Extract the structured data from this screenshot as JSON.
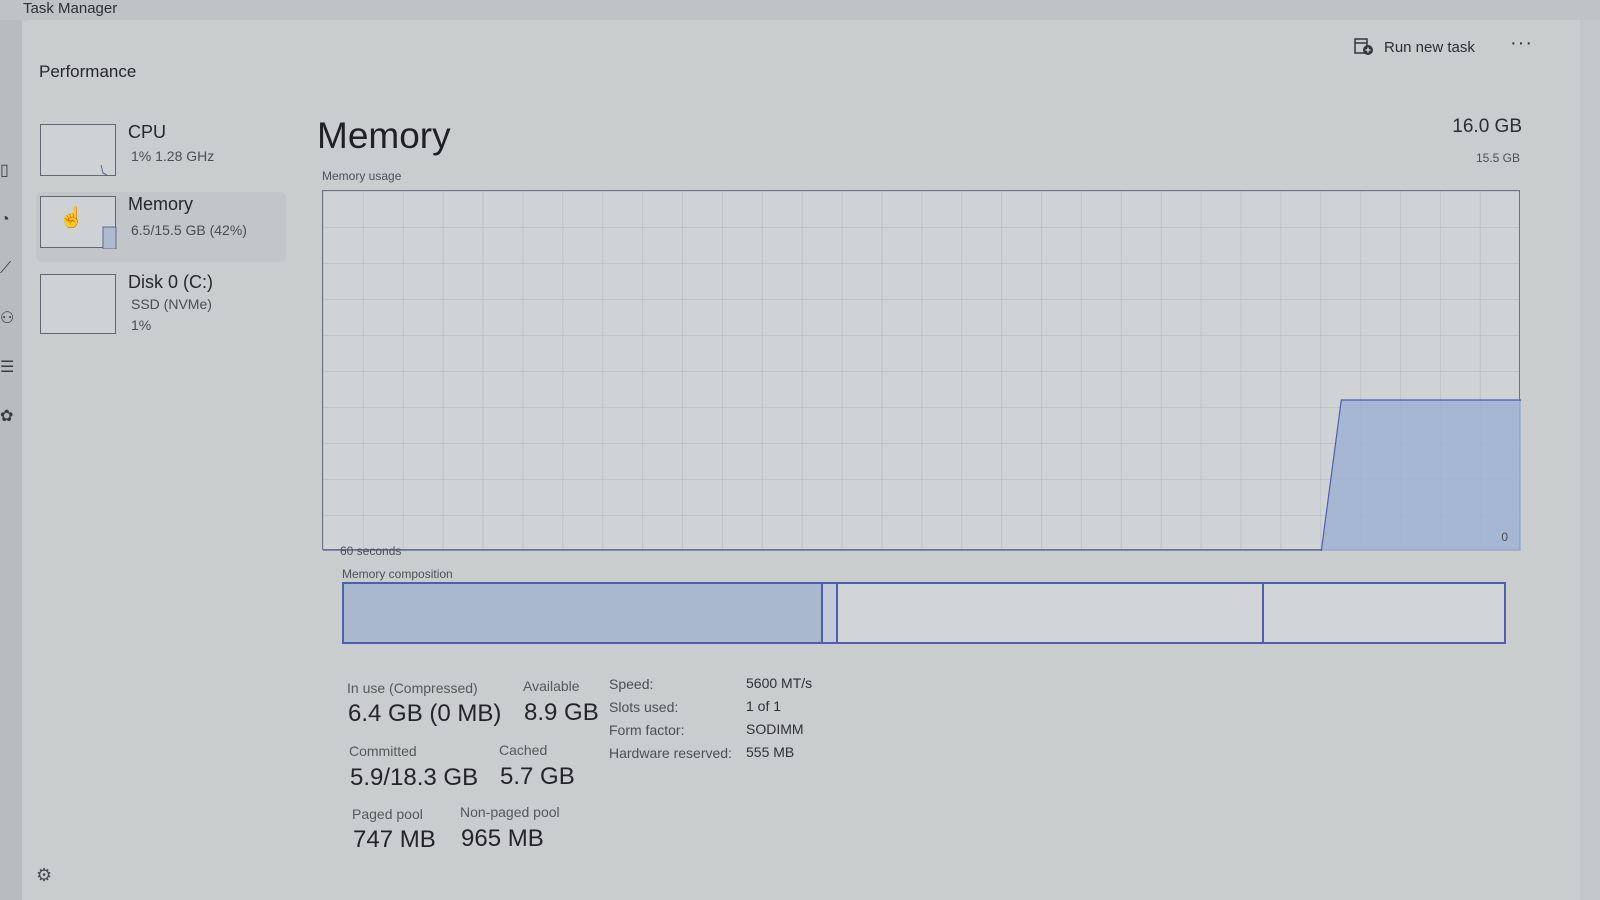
{
  "app": {
    "title": "Task Manager"
  },
  "header": {
    "page_title": "Performance",
    "run_new_task": "Run new task",
    "more": "···"
  },
  "navrail": {
    "icons": [
      "processes-icon",
      "app-history-icon",
      "startup-apps-icon",
      "users-icon",
      "details-icon",
      "services-icon"
    ],
    "settings_icon": "gear-icon"
  },
  "sidebar": {
    "items": [
      {
        "name": "CPU",
        "line1": "1%  1.28 GHz",
        "line2": ""
      },
      {
        "name": "Memory",
        "line1": "6.5/15.5 GB (42%)",
        "line2": "",
        "selected": true
      },
      {
        "name": "Disk 0 (C:)",
        "line1": "SSD (NVMe)",
        "line2": "1%"
      }
    ]
  },
  "memory": {
    "heading": "Memory",
    "total": "16.0 GB",
    "usage_label": "Memory usage",
    "max_label": "15.5 GB",
    "time_label": "60 seconds",
    "zero_label": "0",
    "composition_label": "Memory composition",
    "composition": {
      "in_use": 6.4,
      "modified": 0.2,
      "standby": 5.7,
      "free": 3.2
    }
  },
  "chart_data": {
    "type": "area",
    "title": "Memory usage",
    "xlabel": "60 seconds",
    "ylabel": "",
    "xlim": [
      60,
      0
    ],
    "ylim": [
      0,
      15.5
    ],
    "x": [
      60,
      10,
      9,
      0
    ],
    "values": [
      0,
      0,
      6.5,
      6.5
    ],
    "color": "#9fb2d3"
  },
  "stats": {
    "in_use_label": "In use (Compressed)",
    "in_use_value": "6.4 GB (0 MB)",
    "available_label": "Available",
    "available_value": "8.9 GB",
    "committed_label": "Committed",
    "committed_value": "5.9/18.3 GB",
    "cached_label": "Cached",
    "cached_value": "5.7 GB",
    "paged_label": "Paged pool",
    "paged_value": "747 MB",
    "nonpaged_label": "Non-paged pool",
    "nonpaged_value": "965 MB"
  },
  "info": {
    "speed_label": "Speed:",
    "speed_value": "5600 MT/s",
    "slots_label": "Slots used:",
    "slots_value": "1 of 1",
    "form_label": "Form factor:",
    "form_value": "SODIMM",
    "hw_label": "Hardware reserved:",
    "hw_value": "555 MB"
  }
}
